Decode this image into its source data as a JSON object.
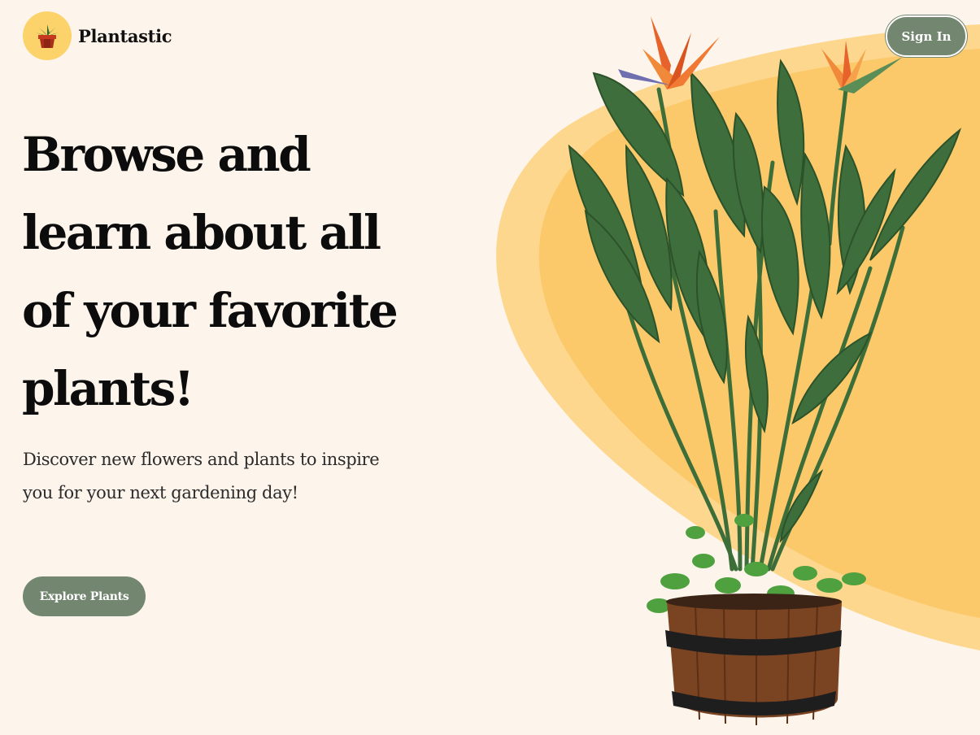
{
  "brand": {
    "name": "Plantastic",
    "logo_icon": "potted-plant-icon"
  },
  "header": {
    "sign_in_label": "Sign In"
  },
  "hero": {
    "title": "Browse and learn about all of your favorite plants!",
    "subtitle": "Discover new flowers and plants to inspire you for your next gardening day!",
    "cta_label": "Explore Plants",
    "image": "bird-of-paradise-plant-in-wooden-barrel-image"
  },
  "colors": {
    "background": "#fdf5ec",
    "accent_yellow": "#fcc96a",
    "accent_yellow_light": "#fdd78e",
    "button_green": "#73866f"
  }
}
